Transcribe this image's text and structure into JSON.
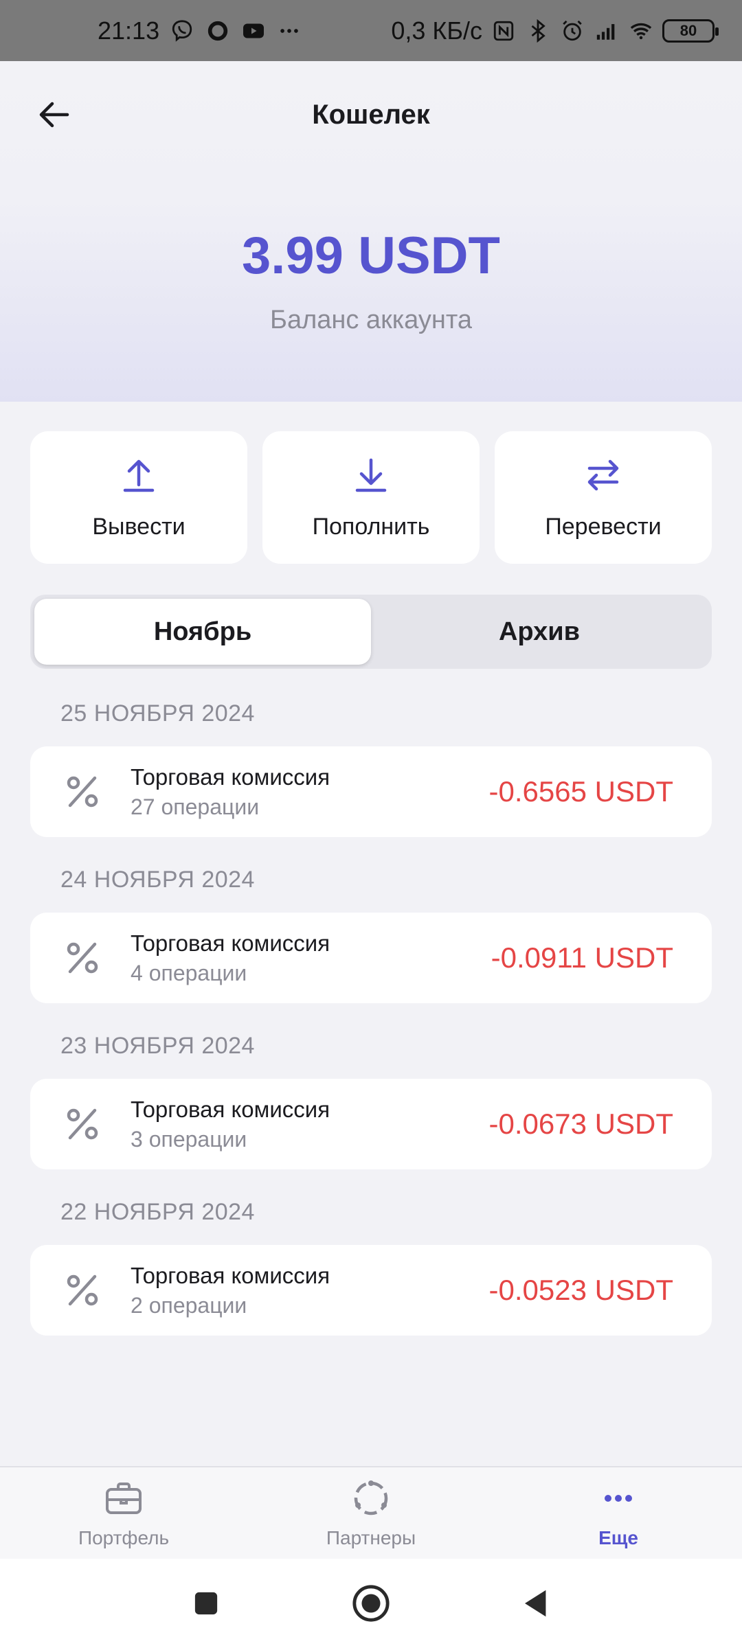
{
  "status_bar": {
    "time": "21:13",
    "network_speed": "0,3 КБ/с",
    "battery": "80",
    "icons": [
      "viber-icon",
      "circle-app-icon",
      "youtube-icon",
      "more-dots-icon",
      "nfc-icon",
      "bluetooth-icon",
      "alarm-icon",
      "signal-icon",
      "wifi-icon",
      "battery-icon"
    ]
  },
  "header": {
    "title": "Кошелек",
    "balance": "3.99 USDT",
    "balance_label": "Баланс аккаунта"
  },
  "actions": [
    {
      "label": "Вывести",
      "icon": "upload-arrow-icon"
    },
    {
      "label": "Пополнить",
      "icon": "download-arrow-icon"
    },
    {
      "label": "Перевести",
      "icon": "swap-arrows-icon"
    }
  ],
  "tabs": [
    {
      "label": "Ноябрь",
      "active": true
    },
    {
      "label": "Архив",
      "active": false
    }
  ],
  "transactions": [
    {
      "date": "25 НОЯБРЯ 2024",
      "name": "Торговая комиссия",
      "count": "27 операции",
      "amount": "-0.6565 USDT"
    },
    {
      "date": "24 НОЯБРЯ 2024",
      "name": "Торговая комиссия",
      "count": "4 операции",
      "amount": "-0.0911 USDT"
    },
    {
      "date": "23 НОЯБРЯ 2024",
      "name": "Торговая комиссия",
      "count": "3 операции",
      "amount": "-0.0673 USDT"
    },
    {
      "date": "22 НОЯБРЯ 2024",
      "name": "Торговая комиссия",
      "count": "2 операции",
      "amount": "-0.0523 USDT"
    }
  ],
  "bottom_nav": [
    {
      "label": "Портфель",
      "icon": "briefcase-icon",
      "active": false
    },
    {
      "label": "Партнеры",
      "icon": "partners-circle-icon",
      "active": false
    },
    {
      "label": "Еще",
      "icon": "more-dots-icon",
      "active": true
    }
  ],
  "colors": {
    "accent": "#5654cf",
    "negative": "#e54545",
    "muted": "#8b8b95",
    "background": "#f2f2f6"
  }
}
